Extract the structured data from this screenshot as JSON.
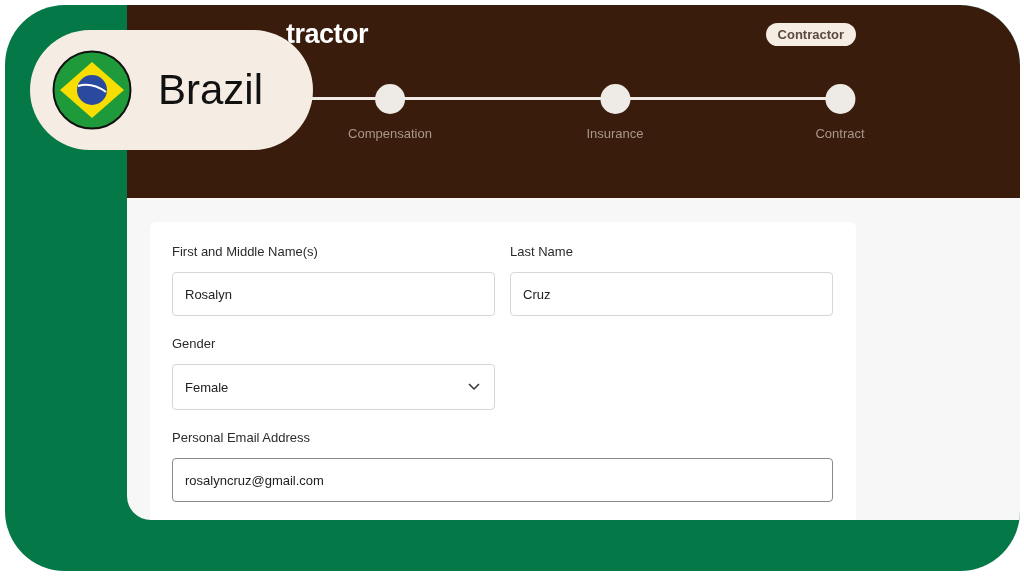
{
  "badge": {
    "country": "Brazil"
  },
  "header": {
    "title": "tractor",
    "tag": "Contractor"
  },
  "steps": [
    {
      "label": "Compensation"
    },
    {
      "label": "Insurance"
    },
    {
      "label": "Contract"
    }
  ],
  "form": {
    "fields": [
      {
        "kind": "text",
        "label": "First and Middle Name(s)",
        "value": "Rosalyn",
        "wide": false,
        "focused": false
      },
      {
        "kind": "text",
        "label": "Last Name",
        "value": "Cruz",
        "wide": false,
        "focused": false
      },
      {
        "kind": "select",
        "label": "Gender",
        "value": "Female",
        "wide": false,
        "focused": false
      },
      {
        "kind": "text",
        "label": "Personal Email Address",
        "value": "rosalyncruz@gmail.com",
        "wide": true,
        "focused": true
      }
    ]
  }
}
